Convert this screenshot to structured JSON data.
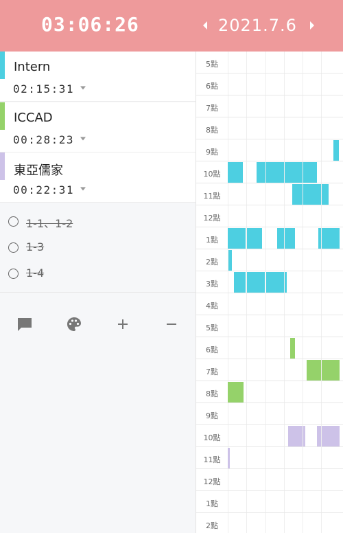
{
  "header": {
    "timer": "03:06:26",
    "date": "2021.7.6",
    "prev_icon": "chevron-left-icon",
    "next_icon": "chevron-right-icon"
  },
  "tasks": [
    {
      "name": "Intern",
      "time": "02:15:31",
      "color": "#4dcfe1"
    },
    {
      "name": "ICCAD",
      "time": "00:28:23",
      "color": "#95d26a"
    },
    {
      "name": "東亞儒家",
      "time": "00:22:31",
      "color": "#cdc2e8"
    }
  ],
  "subtasks": [
    {
      "text": "1-1、1-2",
      "done": true
    },
    {
      "text": "1-3",
      "done": true
    },
    {
      "text": "1-4",
      "done": true
    }
  ],
  "toolbar": [
    {
      "icon": "comment-icon"
    },
    {
      "icon": "palette-icon"
    },
    {
      "icon": "plus-icon"
    },
    {
      "icon": "minus-icon"
    }
  ],
  "timeline": {
    "hours": [
      "5點",
      "6點",
      "7點",
      "8點",
      "9點",
      "10點",
      "11點",
      "12點",
      "1點",
      "2點",
      "3點",
      "4點",
      "5點",
      "6點",
      "7點",
      "8點",
      "9點",
      "10點",
      "11點",
      "12點",
      "1點",
      "2點"
    ]
  }
}
